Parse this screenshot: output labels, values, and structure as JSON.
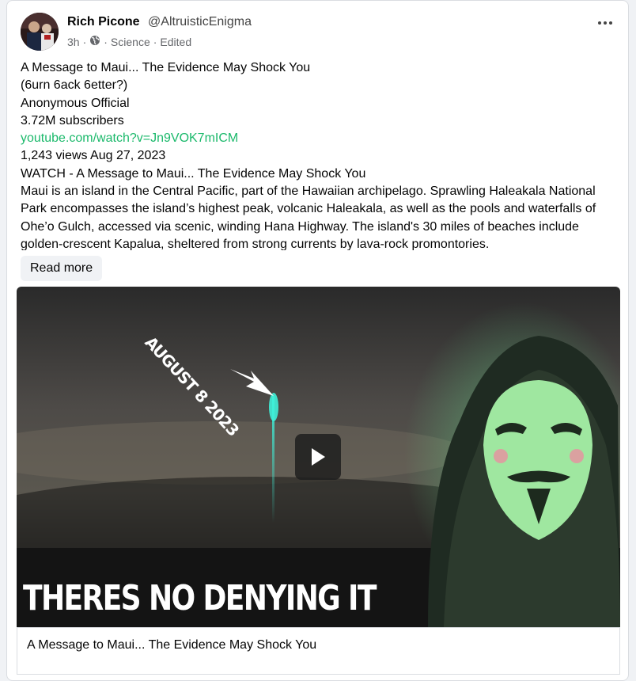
{
  "post": {
    "author_name": "Rich Picone",
    "author_handle": "@AltruisticEnigma",
    "time": "3h",
    "separator": "·",
    "category": "Science",
    "edited": "Edited",
    "audience_icon": "globe-icon",
    "more_icon": "more-horizontal-icon"
  },
  "content": {
    "lines": [
      "A Message to Maui... The Evidence May Shock You",
      "(6urn 6ack 6etter?)",
      "Anonymous Official",
      "3.72M subscribers"
    ],
    "link": "youtube.com/watch?v=Jn9VOK7mICM",
    "views_line": "1,243 views Aug 27, 2023",
    "watch_line": "WATCH - A Message to Maui... The Evidence May Shock You",
    "description": "Maui is an island in the Central Pacific, part of the Hawaiian archipelago. Sprawling Haleakala National Park encompasses the island’s highest peak, volcanic Haleakala, as well as the pools and waterfalls of Ohe’o Gulch, accessed via scenic, winding Hana Highway. The island's 30 miles of beaches include golden-crescent Kapalua, sheltered from strong currents by lava-rock promontories.",
    "read_more": "Read more"
  },
  "video": {
    "stamp_text": "AUGUST 8 2023",
    "caption_text": "THERES NO DENYING IT",
    "play_icon": "play-icon",
    "link_title": "A Message to Maui... The Evidence May Shock You"
  },
  "colors": {
    "link": "#1bb96b",
    "beam": "#3ff0d8",
    "mask_glow": "#63e08a"
  }
}
